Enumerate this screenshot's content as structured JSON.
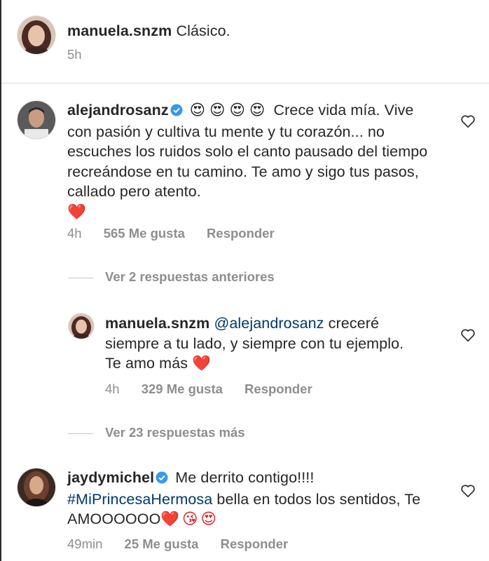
{
  "comments": [
    {
      "username": "manuela.snzm",
      "text": "Clásico.",
      "time": "5h",
      "verified": false
    },
    {
      "username": "alejandrosanz",
      "verified": true,
      "lead_emojis": "😍😍😍😍",
      "text_line1": "Crece vida mía.",
      "text_rest": "Vive con pasión y cultiva tu mente y tu corazón... no escuches los ruidos solo el canto pausado del tiempo recreándose en tu camino. Te amo y sigo tus pasos, callado pero atento.",
      "trailing_emoji": "❤️",
      "time": "4h",
      "likes": "565 Me gusta",
      "reply": "Responder"
    }
  ],
  "view_previous": "Ver 2 respuestas anteriores",
  "reply_comment": {
    "username": "manuela.snzm",
    "mention": "@alejandrosanz",
    "text": "creceré siempre a tu lado, y siempre con tu ejemplo. Te amo más",
    "trailing_emoji": "❤️",
    "time": "4h",
    "likes": "329 Me gusta",
    "reply": "Responder"
  },
  "view_more": "Ver 23 respuestas más",
  "third_comment": {
    "username": "jaydymichel",
    "verified": true,
    "text_line1": "Me derrito contigo!!!!",
    "hashtag": "#MiPrincesaHermosa",
    "text_rest": "bella en todos los sentidos, Te AMOOOOOO",
    "trailing_emojis": "❤️😘😍",
    "time": "49min",
    "likes": "25 Me gusta",
    "reply": "Responder"
  },
  "colors": {
    "text": "#262626",
    "meta": "#8e8e8e",
    "link": "#00376b",
    "verified": "#3897f0",
    "heart_emoji": "#e0202a"
  }
}
